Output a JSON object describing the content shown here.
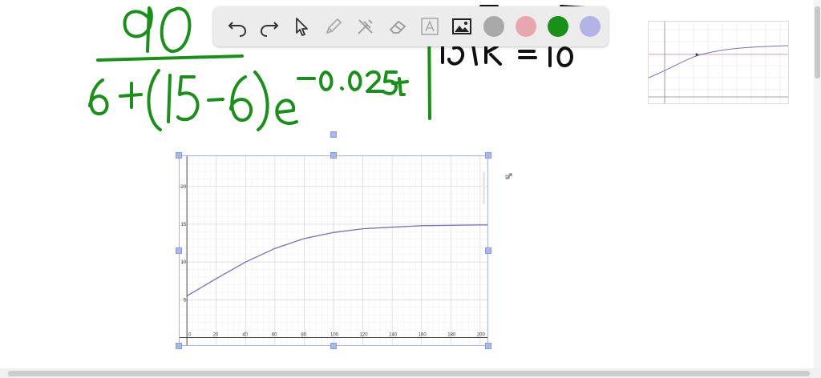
{
  "toolbar": {
    "tools": [
      {
        "name": "undo-icon"
      },
      {
        "name": "redo-icon"
      },
      {
        "name": "pointer-icon"
      },
      {
        "name": "pencil-icon"
      },
      {
        "name": "tools-icon"
      },
      {
        "name": "eraser-icon"
      },
      {
        "name": "text-icon"
      },
      {
        "name": "image-icon"
      }
    ],
    "colors": [
      "#a9a9a9",
      "#e7a7ad",
      "#199119",
      "#b3b3e6"
    ]
  },
  "handwriting": {
    "numerator": "90",
    "denominator": "6+(15-6)e",
    "exponent": "-0.025t",
    "partial_right": "10k = 10"
  },
  "graph": {
    "x_ticks": [
      "0",
      "20",
      "40",
      "60",
      "80",
      "100",
      "120",
      "140",
      "160",
      "180",
      "200"
    ],
    "y_ticks": [
      "5",
      "10",
      "15",
      "-20"
    ]
  },
  "chart_data": {
    "type": "line",
    "series": [
      {
        "x": [
          0,
          20,
          40,
          60,
          80,
          100,
          120,
          140,
          160,
          180,
          200,
          205
        ],
        "y": [
          5.5,
          7.8,
          10.0,
          11.8,
          13.1,
          13.9,
          14.4,
          14.6,
          14.8,
          14.85,
          14.9,
          14.9
        ]
      }
    ],
    "xlim": [
      -5,
      205
    ],
    "ylim": [
      -1,
      24
    ],
    "grid": true,
    "colors": [
      "#7b6fb4"
    ]
  }
}
